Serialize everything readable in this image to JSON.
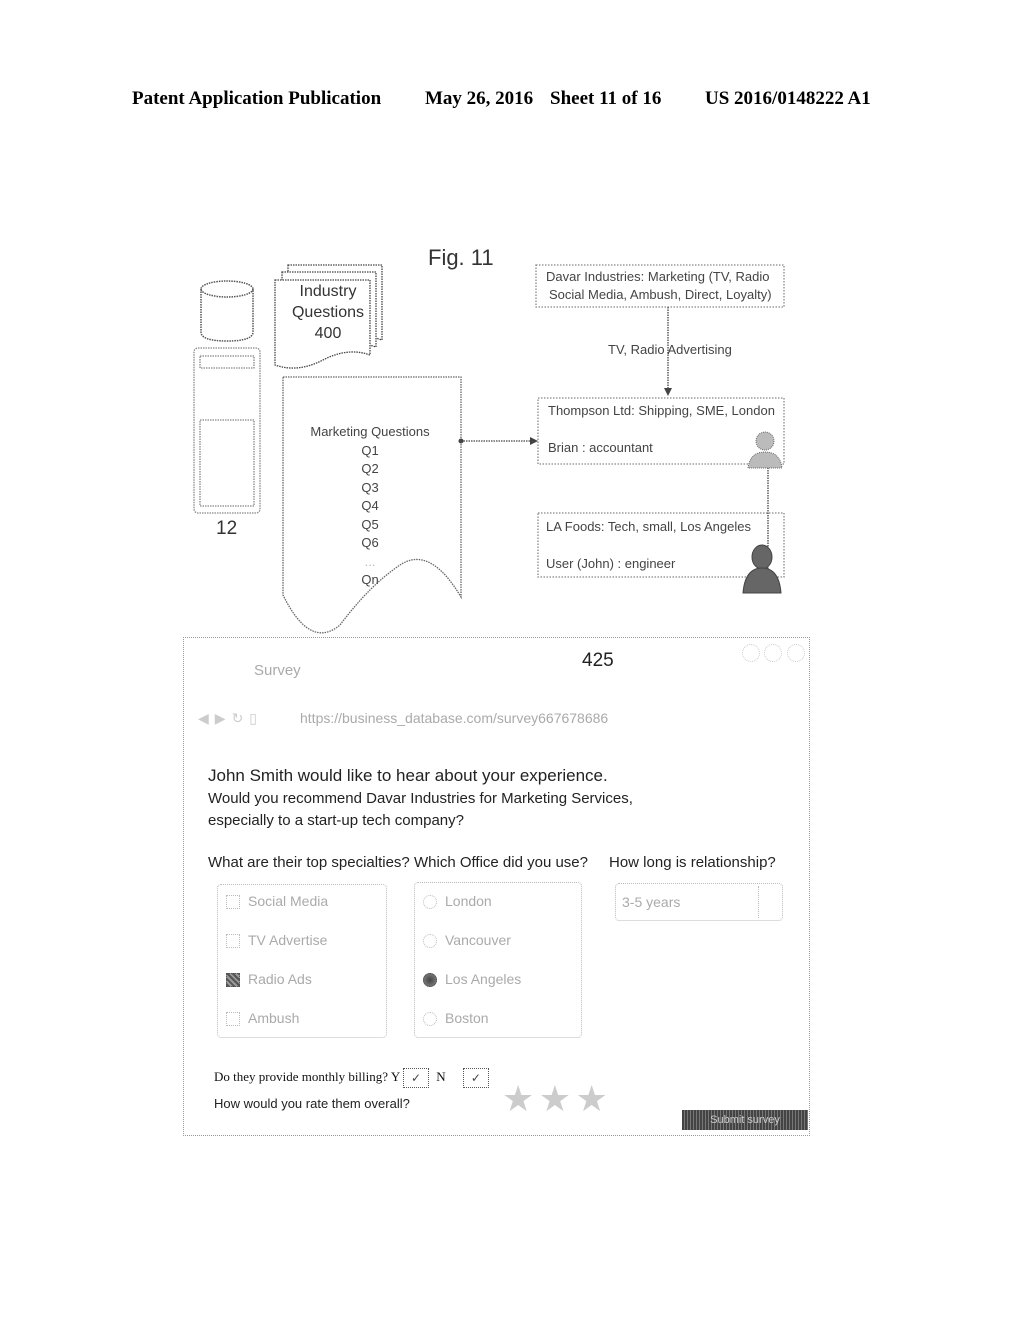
{
  "header": {
    "publication": "Patent Application Publication",
    "date": "May 26, 2016",
    "sheet": "Sheet 11 of 16",
    "number": "US 2016/0148222 A1"
  },
  "figure": {
    "title": "Fig. 11",
    "device_label": "12",
    "industry_questions": {
      "line1": "Industry",
      "line2": "Questions",
      "ref": "400"
    },
    "marketing_questions": {
      "title": "Marketing Questions",
      "items": [
        "Q1",
        "Q2",
        "Q3",
        "Q4",
        "Q5",
        "Q6",
        "...",
        "Qn"
      ]
    },
    "davar_box": {
      "line1": "Davar Industries: Marketing (TV, Radio",
      "line2": "Social Media, Ambush, Direct, Loyalty)"
    },
    "arrow_label": "TV, Radio Advertising",
    "thompson_box": {
      "line1": "Thompson Ltd:  Shipping, SME, London",
      "line2": "Brian : accountant"
    },
    "lafoods_box": {
      "line1": "LA Foods:  Tech,  small, Los Angeles",
      "line2": "User (John) : engineer"
    }
  },
  "survey": {
    "title": "Survey",
    "ref": "425",
    "url": "https://business_database.com/survey667678686",
    "intro": "John Smith would like to hear about your experience.",
    "question_line1": "Would you recommend Davar Industries for Marketing Services,",
    "question_line2": "especially to a start-up tech company?",
    "specialties": {
      "label": "What are their top specialties?",
      "options": [
        {
          "label": "Social Media",
          "checked": false
        },
        {
          "label": "TV Advertise",
          "checked": false
        },
        {
          "label": "Radio Ads",
          "checked": true
        },
        {
          "label": "Ambush",
          "checked": false
        }
      ]
    },
    "office": {
      "label": "Which Office did you use?",
      "options": [
        {
          "label": "London",
          "selected": false
        },
        {
          "label": "Vancouver",
          "selected": false
        },
        {
          "label": "Los Angeles",
          "selected": true
        },
        {
          "label": "Boston",
          "selected": false
        }
      ]
    },
    "relationship": {
      "label": "How long is relationship?",
      "value": "3-5 years"
    },
    "billing": {
      "label": "Do they provide monthly billing?",
      "yes": "Y",
      "no": "N",
      "check_glyph": "✓"
    },
    "rating": {
      "label": "How would you rate them overall?",
      "stars": 3,
      "star_glyph": "★"
    },
    "submit_label": "Submit survey"
  }
}
